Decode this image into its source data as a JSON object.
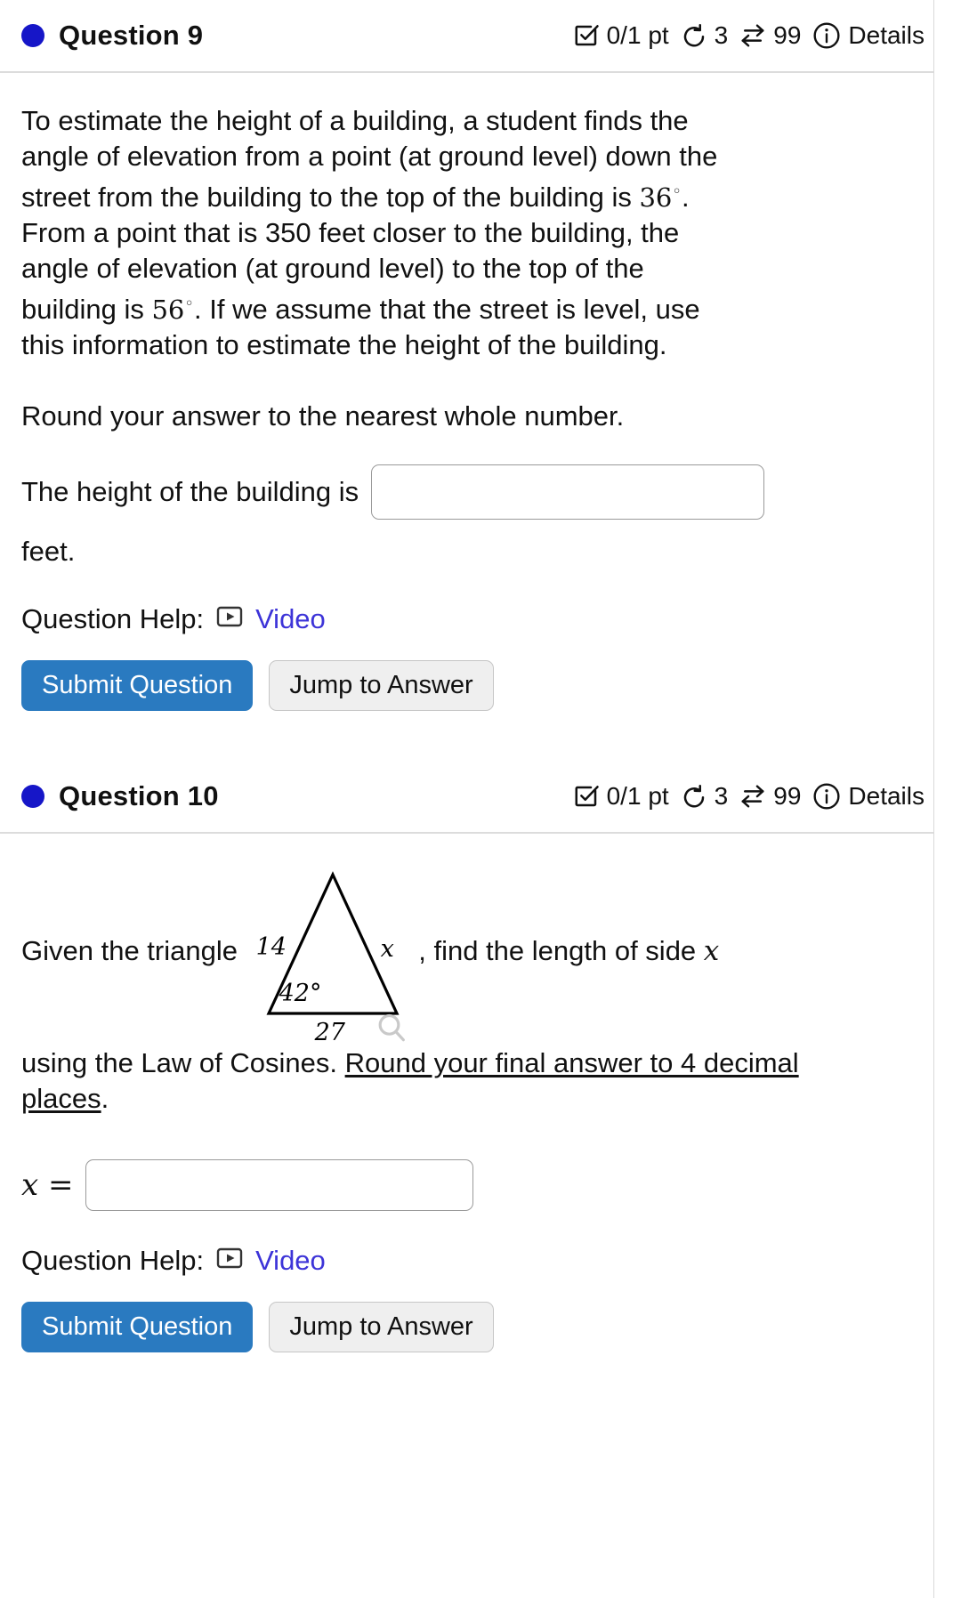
{
  "questions": [
    {
      "bullet_color": "#1616c8",
      "title": "Question 9",
      "meta": {
        "points": "0/1 pt",
        "attempts": "3",
        "versions": "99",
        "details_label": "Details"
      },
      "body_lines": [
        "To estimate the height of a building, a student finds the",
        "angle of elevation from a point (at ground level) down the",
        "street from the building to the top of the building is ",
        "From a point that is 350 feet closer to the building, the",
        "angle of elevation (at ground level) to the top of the",
        "building is ",
        "this information to estimate the height of the building."
      ],
      "angle_1": "36",
      "angle_2": "56",
      "after_angle_2": ". If we assume that the street is level, use",
      "rounding_note": "Round your answer to the nearest whole number.",
      "answer_prefix": "The height of the building is",
      "answer_suffix": "feet.",
      "answer_value": "",
      "answer_placeholder": "",
      "help_label": "Question Help:",
      "video_label": "Video",
      "submit_label": "Submit Question",
      "jump_label": "Jump to Answer"
    },
    {
      "bullet_color": "#1616c8",
      "title": "Question 10",
      "meta": {
        "points": "0/1 pt",
        "attempts": "3",
        "versions": "99",
        "details_label": "Details"
      },
      "prompt_before": "Given the triangle",
      "prompt_middle": ", find the length of side",
      "prompt_var": "x",
      "prompt_line2_a": "using the Law of Cosines. ",
      "prompt_line2_underlined": "Round your final answer to 4 decimal places",
      "prompt_line2_end": ".",
      "triangle": {
        "side_left": "14",
        "side_right": "x",
        "angle": "42°",
        "side_bottom": "27"
      },
      "answer_prefix": "x =",
      "answer_value": "",
      "answer_placeholder": "",
      "help_label": "Question Help:",
      "video_label": "Video",
      "submit_label": "Submit Question",
      "jump_label": "Jump to Answer"
    }
  ],
  "icons": {
    "checkbox": "checkbox-check-icon",
    "retry": "undo-arrow-icon",
    "swap": "swap-arrows-icon",
    "info": "info-circle-icon",
    "video": "video-play-icon",
    "magnifier": "magnifier-icon"
  },
  "colors": {
    "primary_button": "#2a7ac0",
    "link": "#3d34d8",
    "bullet": "#1616c8",
    "divider": "#dcdcdc"
  }
}
